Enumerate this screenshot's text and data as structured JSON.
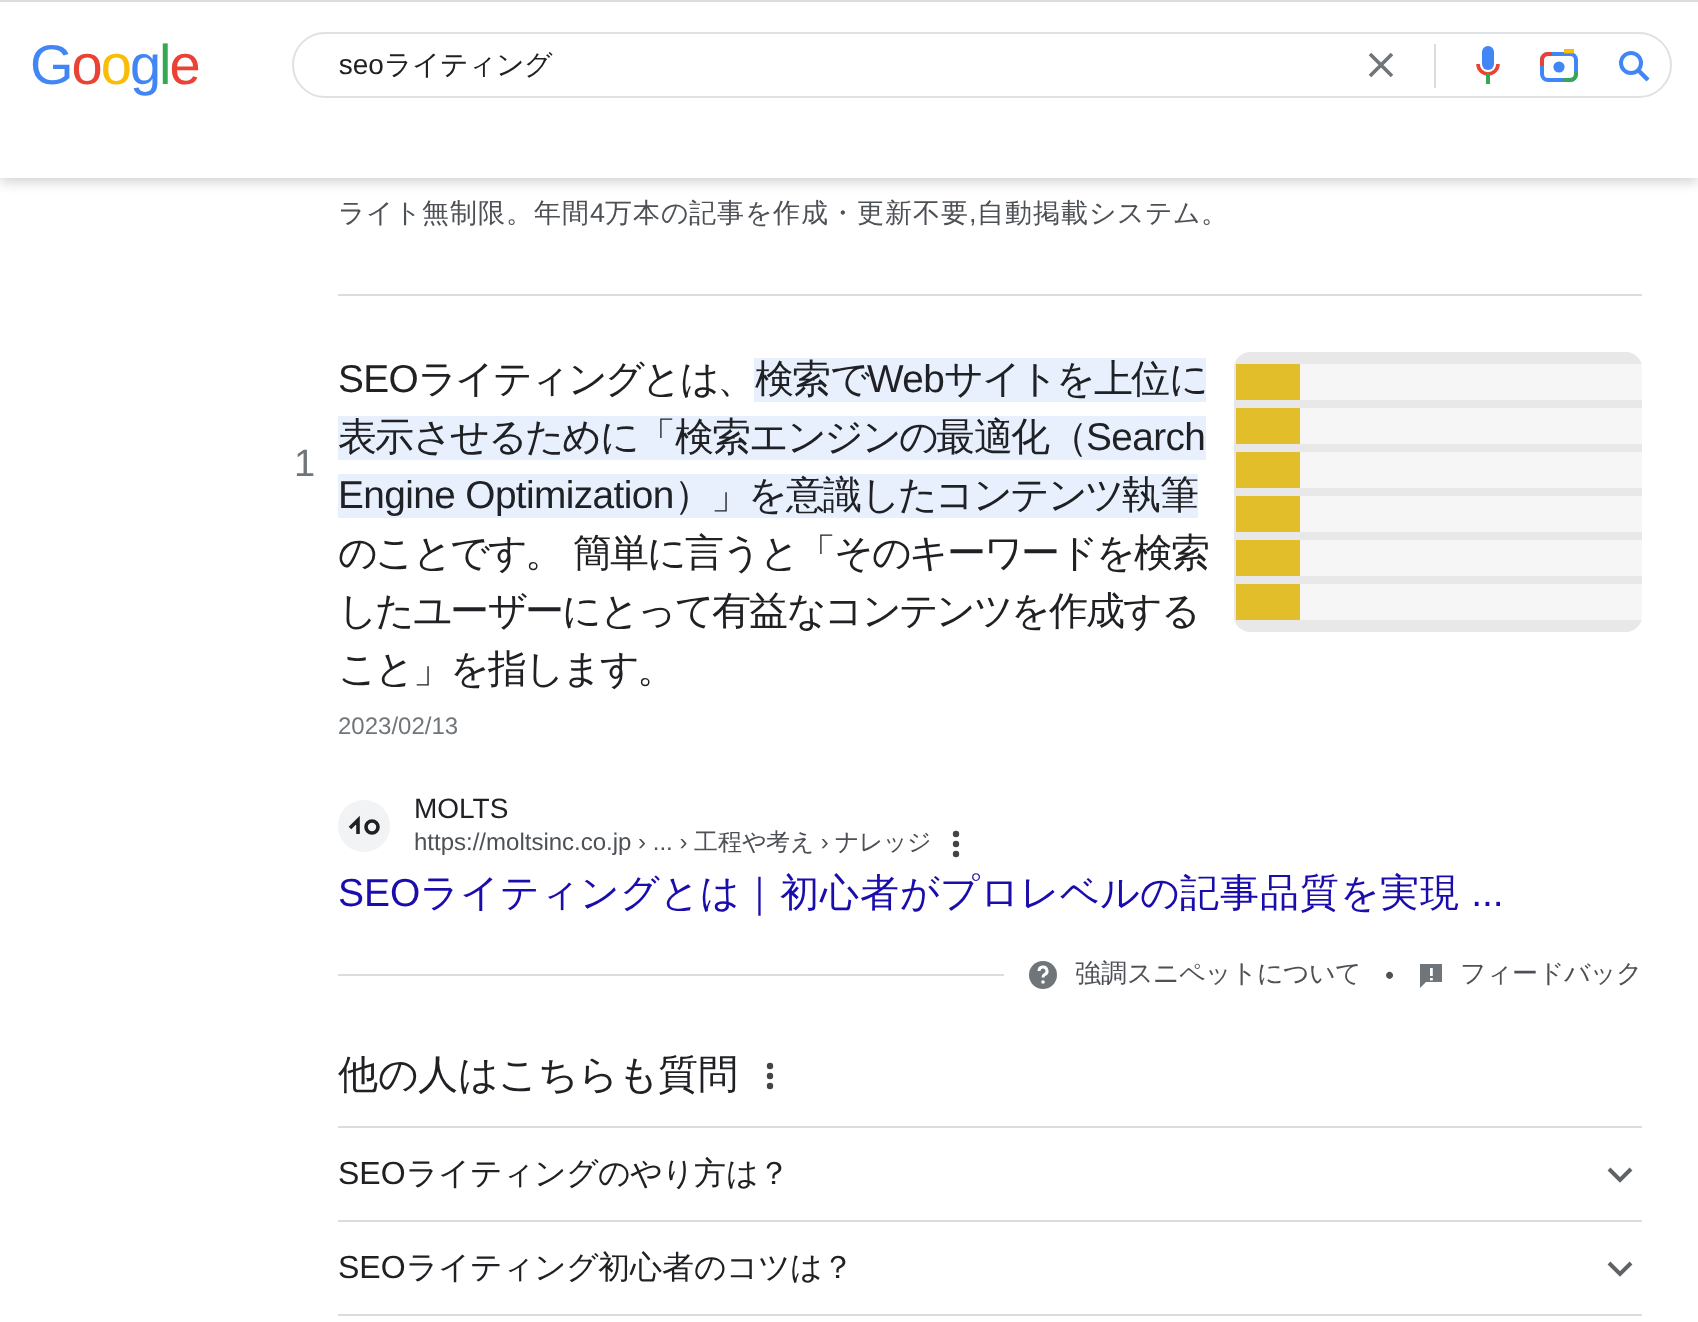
{
  "header": {
    "logo": "Google",
    "search": {
      "value": "seoライティング"
    }
  },
  "ad_tail": "ライト無制限。年間4万本の記事を作成・更新不要,自動掲載システム。",
  "snippet": {
    "number": "1",
    "parts": [
      {
        "text": "SEOライティングとは、",
        "highlighted": false
      },
      {
        "text": "検索でWebサイトを上位に表示させるために「検索エンジンの最適化（Search Engine Optimization）」を意識したコンテンツ執筆",
        "highlighted": true
      },
      {
        "text": "のことです。 簡単に言うと「そのキーワードを検索したユーザーにとって有益なコンテンツを作成すること」を指します。",
        "highlighted": false
      }
    ],
    "date": "2023/02/13",
    "source": {
      "site": "MOLTS",
      "url": "https://moltsinc.co.jp › ... › 工程や考え › ナレッジ"
    },
    "title": "SEOライティングとは｜初心者がプロレベルの記事品質を実現 ...",
    "about": "強調スニペットについて",
    "separator": "•",
    "feedback": "フィードバック"
  },
  "people_also_ask": {
    "heading": "他の人はこちらも質問",
    "questions": [
      {
        "text": "SEOライティングのやり方は？",
        "expanded": false
      },
      {
        "text": "SEOライティング初心者のコツは？",
        "expanded": false
      }
    ]
  }
}
